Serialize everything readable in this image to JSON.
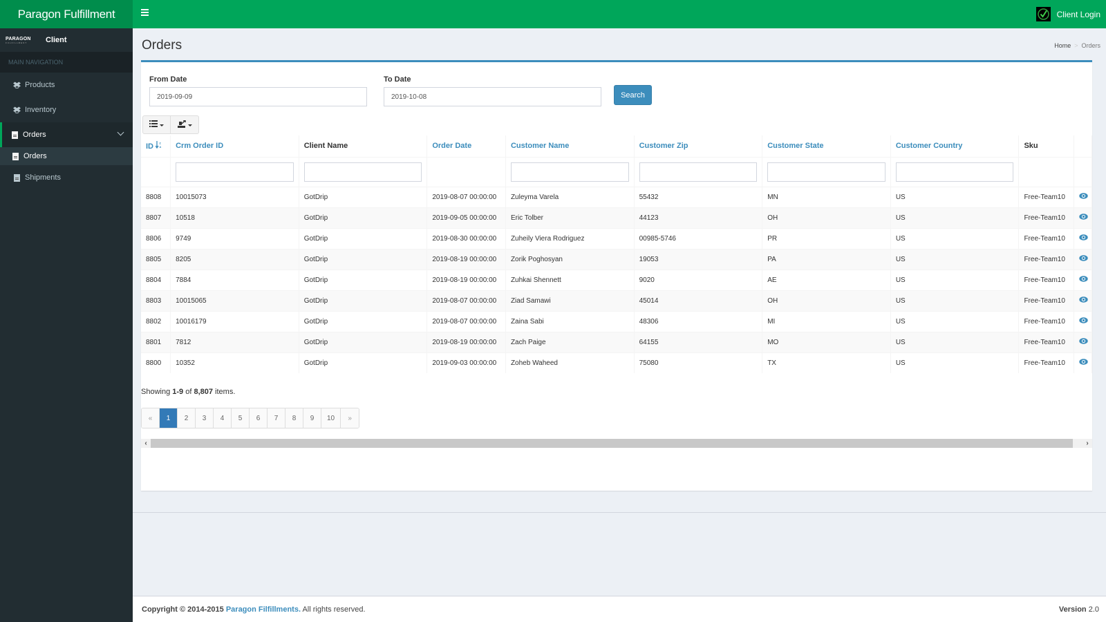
{
  "app": {
    "brand": "Paragon Fulfillment",
    "user_label": "Client Login",
    "accent_color": "#00a65a",
    "link_color": "#3c8dbc"
  },
  "sidebar": {
    "logo_text": "PARAGON",
    "logo_subtext": "FULFILLMENT",
    "user_name": "Client",
    "header": "MAIN NAVIGATION",
    "items": [
      {
        "label": "Products",
        "icon": "dropbox-icon"
      },
      {
        "label": "Inventory",
        "icon": "dropbox-icon"
      },
      {
        "label": "Orders",
        "icon": "file-icon",
        "active": true,
        "expanded": true
      },
      {
        "label": "Shipments",
        "icon": "file-icon"
      }
    ],
    "sub_items": [
      {
        "label": "Orders",
        "icon": "file-icon"
      }
    ]
  },
  "page": {
    "title": "Orders",
    "breadcrumb": [
      "Home",
      "Orders"
    ]
  },
  "filters": {
    "from_label": "From Date",
    "from_value": "2019-09-09",
    "to_label": "To Date",
    "to_value": "2019-10-08",
    "search_label": "Search"
  },
  "toolbar": {
    "columns_icon": "list-icon",
    "export_icon": "export-icon"
  },
  "table": {
    "columns": [
      {
        "label": "ID",
        "sortable": true,
        "sorted": "desc"
      },
      {
        "label": "Crm Order ID",
        "sortable": true
      },
      {
        "label": "Client Name",
        "sortable": false
      },
      {
        "label": "Order Date",
        "sortable": true
      },
      {
        "label": "Customer Name",
        "sortable": true
      },
      {
        "label": "Customer Zip",
        "sortable": true
      },
      {
        "label": "Customer State",
        "sortable": true
      },
      {
        "label": "Customer Country",
        "sortable": true
      },
      {
        "label": "Sku",
        "sortable": false
      },
      {
        "label": "",
        "sortable": false
      }
    ],
    "rows": [
      {
        "id": "8808",
        "crm": "10015073",
        "client": "GotDrip",
        "date": "2019-08-07 00:00:00",
        "customer": "Zuleyma Varela",
        "zip": "55432",
        "state": "MN",
        "country": "US",
        "sku": "Free-Team10"
      },
      {
        "id": "8807",
        "crm": "10518",
        "client": "GotDrip",
        "date": "2019-09-05 00:00:00",
        "customer": "Eric Tolber",
        "zip": "44123",
        "state": "OH",
        "country": "US",
        "sku": "Free-Team10"
      },
      {
        "id": "8806",
        "crm": "9749",
        "client": "GotDrip",
        "date": "2019-08-30 00:00:00",
        "customer": "Zuheily Viera Rodriguez",
        "zip": "00985-5746",
        "state": "PR",
        "country": "US",
        "sku": "Free-Team10"
      },
      {
        "id": "8805",
        "crm": "8205",
        "client": "GotDrip",
        "date": "2019-08-19 00:00:00",
        "customer": "Zorik Poghosyan",
        "zip": "19053",
        "state": "PA",
        "country": "US",
        "sku": "Free-Team10"
      },
      {
        "id": "8804",
        "crm": "7884",
        "client": "GotDrip",
        "date": "2019-08-19 00:00:00",
        "customer": "Zuhkai Shennett",
        "zip": "9020",
        "state": "AE",
        "country": "US",
        "sku": "Free-Team10"
      },
      {
        "id": "8803",
        "crm": "10015065",
        "client": "GotDrip",
        "date": "2019-08-07 00:00:00",
        "customer": "Ziad Samawi",
        "zip": "45014",
        "state": "OH",
        "country": "US",
        "sku": "Free-Team10"
      },
      {
        "id": "8802",
        "crm": "10016179",
        "client": "GotDrip",
        "date": "2019-08-07 00:00:00",
        "customer": "Zaina Sabi",
        "zip": "48306",
        "state": "MI",
        "country": "US",
        "sku": "Free-Team10"
      },
      {
        "id": "8801",
        "crm": "7812",
        "client": "GotDrip",
        "date": "2019-08-19 00:00:00",
        "customer": "Zach Paige",
        "zip": "64155",
        "state": "MO",
        "country": "US",
        "sku": "Free-Team10"
      },
      {
        "id": "8800",
        "crm": "10352",
        "client": "GotDrip",
        "date": "2019-09-03 00:00:00",
        "customer": "Zoheb Waheed",
        "zip": "75080",
        "state": "TX",
        "country": "US",
        "sku": "Free-Team10"
      }
    ]
  },
  "summary": {
    "prefix": "Showing ",
    "range": "1-9",
    "middle": " of ",
    "total": "8,807",
    "suffix": " items."
  },
  "pagination": {
    "prev": "«",
    "pages": [
      "1",
      "2",
      "3",
      "4",
      "5",
      "6",
      "7",
      "8",
      "9",
      "10"
    ],
    "current": "1",
    "next": "»"
  },
  "footer": {
    "copyright": "Copyright © 2014-2015",
    "company": "Paragon Filfillments.",
    "rights": "All rights reserved.",
    "version_label": "Version",
    "version": "2.0"
  }
}
